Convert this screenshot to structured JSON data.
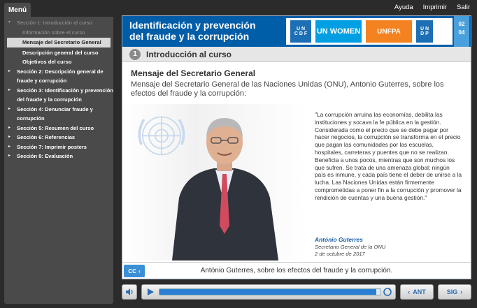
{
  "topbar": {
    "menu_tab": "Menú",
    "links": [
      "Ayuda",
      "Imprimir",
      "Salir"
    ]
  },
  "sidebar": {
    "items": [
      {
        "label": "Sección 1: Introducción al curso",
        "state": "dim",
        "arrow": "▾"
      },
      {
        "label": "Información sobre el curso",
        "state": "dim-sub",
        "arrow": ""
      },
      {
        "label": "Mensaje del Secretario General",
        "state": "selected",
        "arrow": ""
      },
      {
        "label": "Descripción general del curso",
        "state": "sub",
        "arrow": ""
      },
      {
        "label": "Objetivos del curso",
        "state": "sub",
        "arrow": ""
      },
      {
        "label": "Sección 2: Descripción general de",
        "state": "normal",
        "arrow": "▸"
      },
      {
        "label": "fraude y corrupción",
        "state": "cont",
        "arrow": ""
      },
      {
        "label": "Sección 3: Identificación y prevención",
        "state": "normal",
        "arrow": "▸"
      },
      {
        "label": "del fraude y la corrupción",
        "state": "cont",
        "arrow": ""
      },
      {
        "label": "Sección 4: Denunciar fraude y",
        "state": "normal",
        "arrow": "▸"
      },
      {
        "label": "corrupción",
        "state": "cont",
        "arrow": ""
      },
      {
        "label": "Sección 5: Resumen del curso",
        "state": "normal",
        "arrow": "▸"
      },
      {
        "label": "Sección 6: Referencias",
        "state": "normal",
        "arrow": "▸"
      },
      {
        "label": "Sección 7: Imprimir posters",
        "state": "normal",
        "arrow": "▸"
      },
      {
        "label": "Sección 8: Evaluación",
        "state": "normal",
        "arrow": "▸"
      }
    ]
  },
  "header": {
    "title_line1": "Identificación y prevención",
    "title_line2": "del fraude y la corrupción",
    "logos": {
      "uncdf_top": "U N",
      "uncdf_bottom": "C D F",
      "women": "UN WOMEN",
      "unfpa": "UNFPA",
      "undp_top": "U N",
      "undp_bottom": "D P"
    },
    "page_current": "02",
    "page_total": "04"
  },
  "section": {
    "number": "1",
    "title": "Introducción al curso"
  },
  "main": {
    "heading": "Mensaje del Secretario General",
    "intro": "Mensaje del Secretario General de las Naciones Unidas (ONU), Antonio Guterres, sobre los efectos del fraude y la corrupción:",
    "quote": "\"La corrupción arruina las economías, debilita las instituciones y socava la fe pública en la gestión. Considerada como el precio que se debe pagar por hacer negocios, la corrupción se transforma en el precio que pagan las comunidades por las escuelas, hospitales, carreteras y puentes que no se realizan. Beneficia a unos pocos, mientras que son muchos los que sufren. Se trata de una amenaza global; ningún país es inmune, y cada país tiene el deber de unirse a la lucha. Las Naciones Unidas están firmemente comprometidas a poner fin a la corrupción y promover la rendición de cuentas y una buena gestión.\"",
    "quote_author": "António Guterres",
    "quote_role": "Secretario General de la ONU",
    "quote_date": "2 de octubre de 2017"
  },
  "caption": {
    "cc_label": "CC",
    "text": "António Guterres, sobre los efectos del fraude y la corrupción."
  },
  "controls": {
    "prev_label": "ANT",
    "next_label": "SIG",
    "progress": 0.98
  },
  "colors": {
    "header_blue": "#005da8",
    "accent_blue": "#2a7fd4",
    "menu_bg": "#4a4a4a"
  }
}
